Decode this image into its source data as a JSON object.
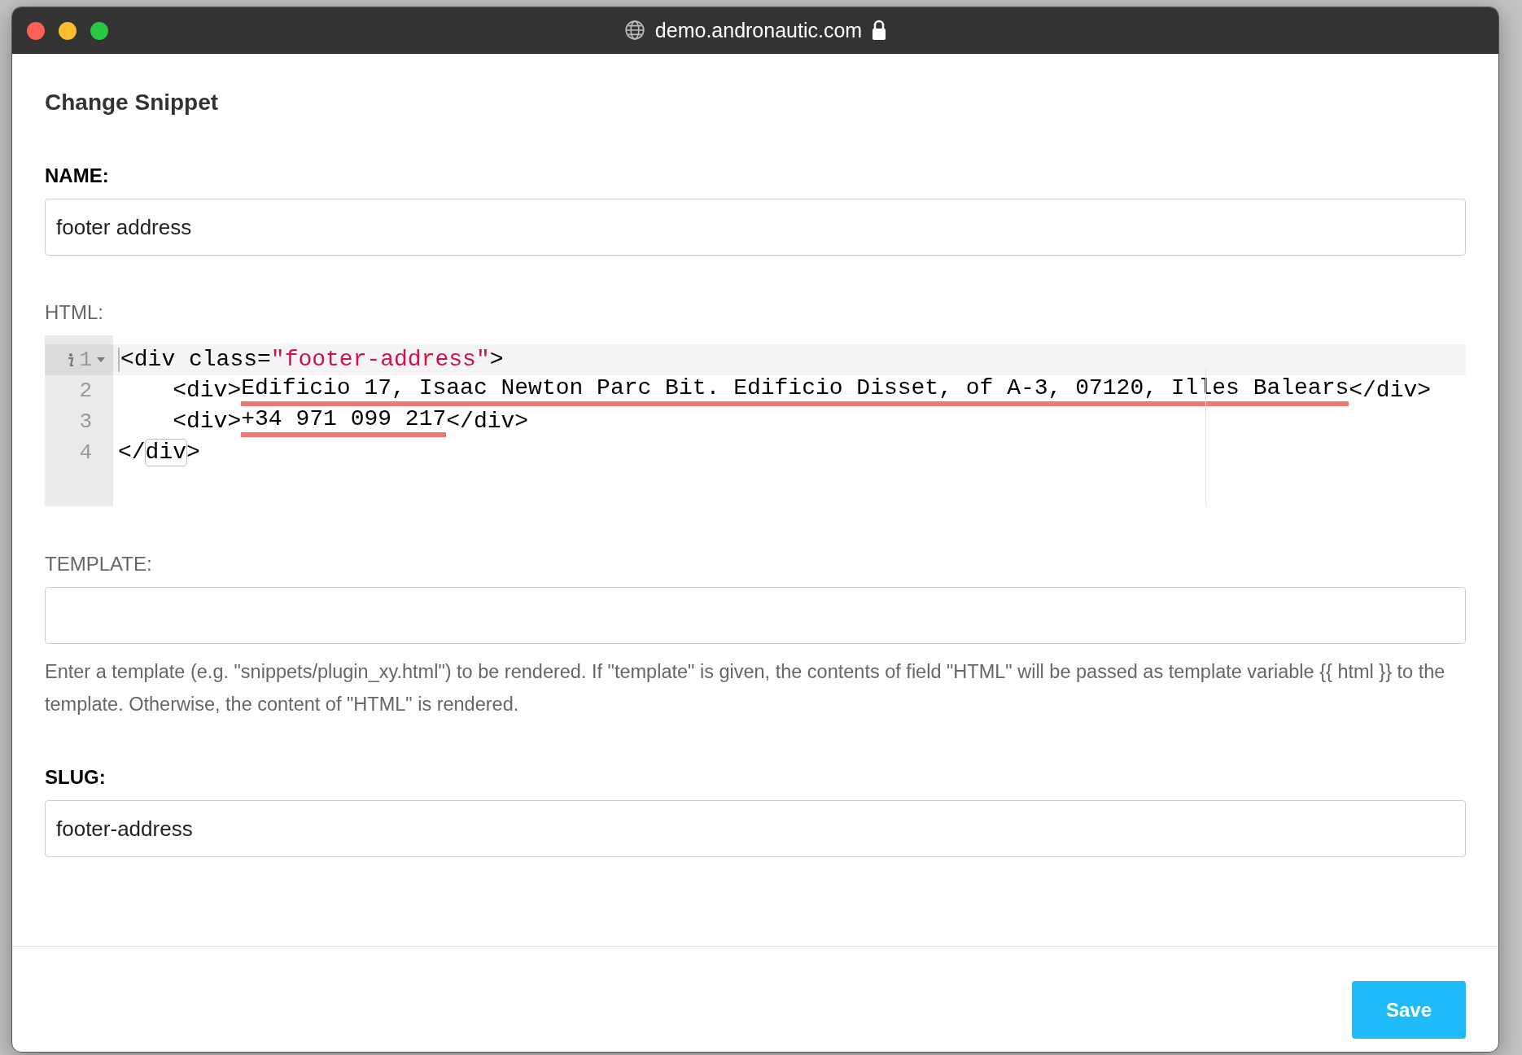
{
  "window": {
    "title": "demo.andronautic.com"
  },
  "dialog": {
    "title": "Change Snippet"
  },
  "name_field": {
    "label": "NAME:",
    "value": "footer address"
  },
  "html_editor": {
    "label": "HTML:",
    "lines": [
      {
        "number": "1",
        "active": true,
        "info": true,
        "foldable": true,
        "segments": [
          {
            "text": "<div class=",
            "kind": "plain"
          },
          {
            "text": "\"footer-address\"",
            "kind": "string"
          },
          {
            "text": ">",
            "kind": "plain"
          }
        ]
      },
      {
        "number": "2",
        "active": false,
        "info": false,
        "foldable": false,
        "segments": [
          {
            "text": "    <div>",
            "kind": "plain"
          },
          {
            "text": "Edificio 17, Isaac Newton Parc Bit. Edificio Disset, of A-3, 07120, Illes Balears",
            "kind": "flagged"
          },
          {
            "text": "</div>",
            "kind": "plain"
          }
        ]
      },
      {
        "number": "3",
        "active": false,
        "info": false,
        "foldable": false,
        "segments": [
          {
            "text": "    <div>",
            "kind": "plain"
          },
          {
            "text": "+34 971 099 217",
            "kind": "flagged"
          },
          {
            "text": "</div>",
            "kind": "plain"
          }
        ]
      },
      {
        "number": "4",
        "active": false,
        "info": false,
        "foldable": false,
        "segments": [
          {
            "text": "</",
            "kind": "plain"
          },
          {
            "text": "div",
            "kind": "matched"
          },
          {
            "text": ">",
            "kind": "plain"
          }
        ]
      }
    ]
  },
  "template_field": {
    "label": "TEMPLATE:",
    "help": "Enter a template (e.g. \"snippets/plugin_xy.html\") to be rendered. If \"template\" is given, the contents of field \"HTML\" will be passed as template variable {{ html }} to the template. Otherwise, the content of \"HTML\" is rendered."
  },
  "slug_field": {
    "label": "SLUG:",
    "value": "footer-address"
  },
  "buttons": [
    {
      "label": "Save"
    }
  ]
}
